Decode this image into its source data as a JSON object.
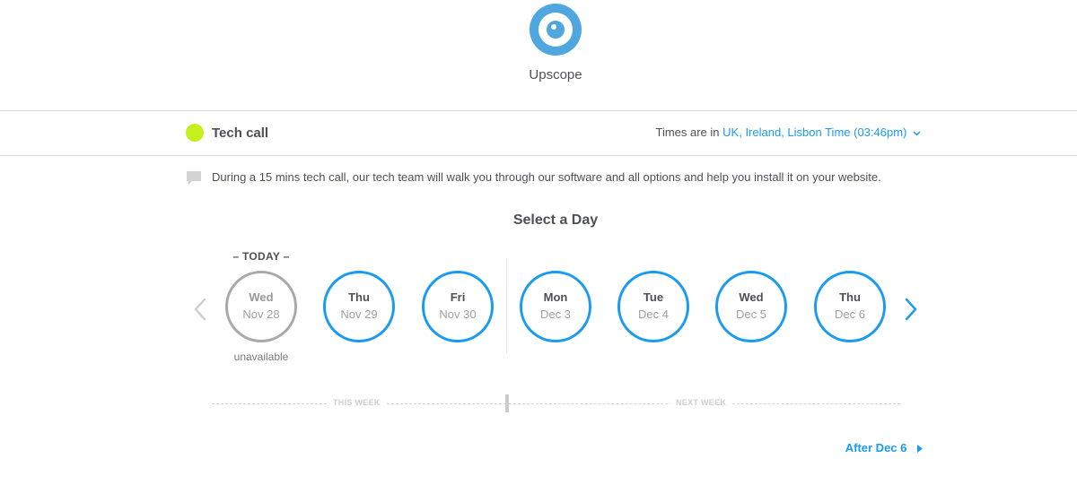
{
  "header": {
    "company_name": "Upscope",
    "logo_icon": "eye-logo",
    "brand_color": "#50a6de"
  },
  "event": {
    "name": "Tech call",
    "dot_color": "#c6f01c",
    "timezone_prefix": "Times are in",
    "timezone_value": "UK, Ireland, Lisbon Time (03:46pm)",
    "timezone_icon": "chevron-down-icon",
    "description_icon": "speech-bubble-icon",
    "description": "During a 15 mins tech call, our tech team will walk you through our software and all options and help you install it on your website."
  },
  "picker": {
    "title": "Select a Day",
    "today_label": "– TODAY –",
    "unavailable_note": "unavailable",
    "prev_icon": "chevron-left-icon",
    "next_icon": "chevron-right-icon",
    "accent_color": "#1a9bf2",
    "days": [
      {
        "dow": "Wed",
        "date": "Nov 28",
        "available": false
      },
      {
        "dow": "Thu",
        "date": "Nov 29",
        "available": true
      },
      {
        "dow": "Fri",
        "date": "Nov 30",
        "available": true
      },
      {
        "dow": "Mon",
        "date": "Dec 3",
        "available": true
      },
      {
        "dow": "Tue",
        "date": "Dec 4",
        "available": true
      },
      {
        "dow": "Wed",
        "date": "Dec 5",
        "available": true
      },
      {
        "dow": "Thu",
        "date": "Dec 6",
        "available": true
      }
    ],
    "this_week_label": "THIS WEEK",
    "next_week_label": "NEXT WEEK",
    "after_link": "After Dec 6",
    "after_icon": "caret-right-icon"
  }
}
